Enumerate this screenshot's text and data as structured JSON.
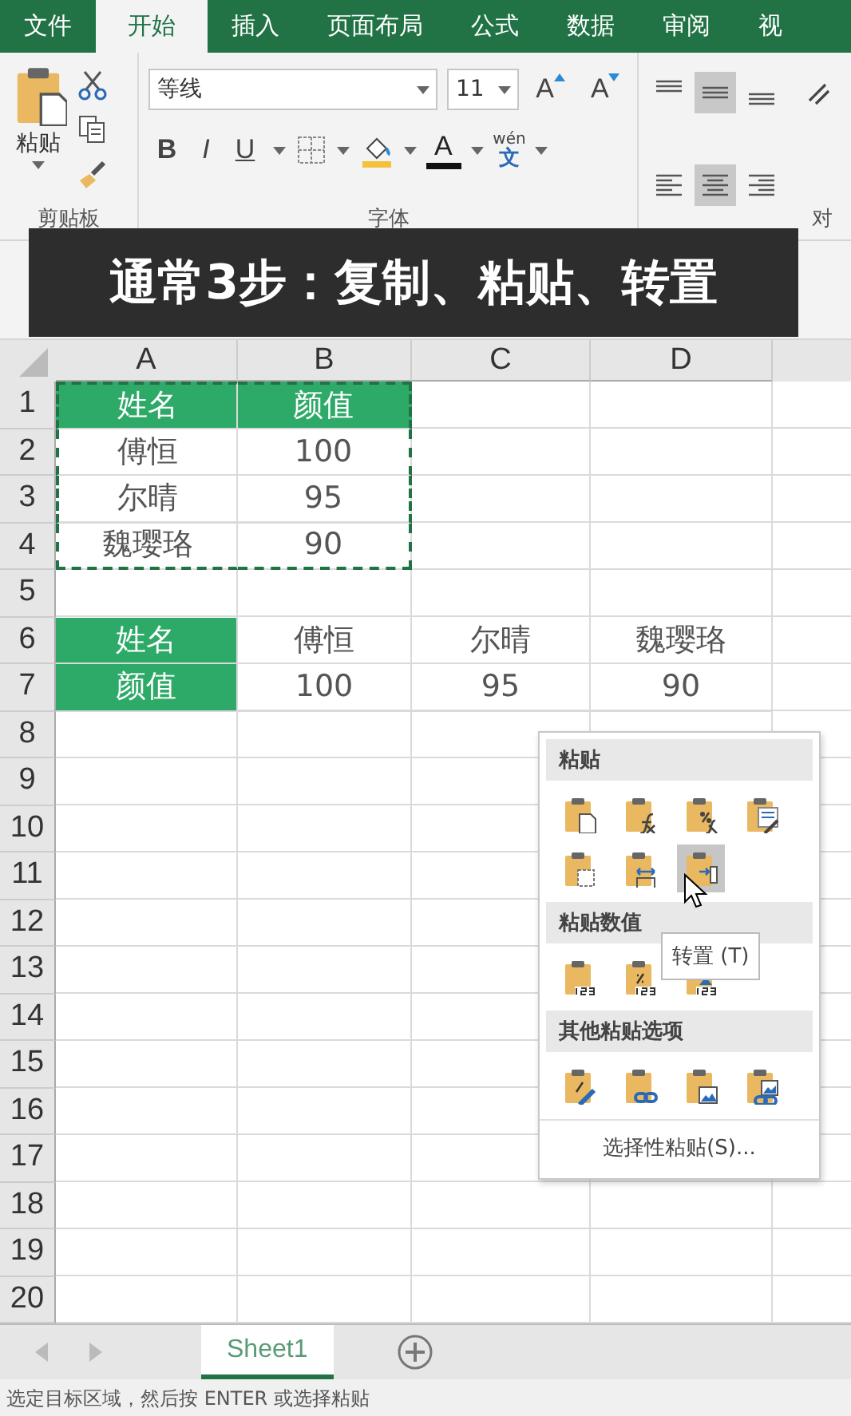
{
  "tabs": [
    {
      "label": "文件",
      "selected": false
    },
    {
      "label": "开始",
      "selected": true
    },
    {
      "label": "插入",
      "selected": false
    },
    {
      "label": "页面布局",
      "selected": false
    },
    {
      "label": "公式",
      "selected": false
    },
    {
      "label": "数据",
      "selected": false
    },
    {
      "label": "审阅",
      "selected": false
    },
    {
      "label": "视",
      "selected": false
    }
  ],
  "ribbon": {
    "paste_label": "粘贴",
    "font_name": "等线",
    "font_size": "11",
    "grow_font": "A",
    "shrink_font": "A",
    "format_buttons": [
      "B",
      "I",
      "U"
    ],
    "font_color": "A",
    "phonetic_top": "wén",
    "phonetic_bottom": "文",
    "align_buttons": [
      {
        "kind": "top",
        "selected": false
      },
      {
        "kind": "middle",
        "selected": true
      },
      {
        "kind": "bottom",
        "selected": false
      },
      {
        "kind": "left",
        "selected": false
      },
      {
        "kind": "center",
        "selected": true
      },
      {
        "kind": "right",
        "selected": false
      }
    ],
    "groups": [
      "剪贴板",
      "字体",
      "对"
    ]
  },
  "caption": "通常3步：复制、粘贴、转置",
  "sheet": {
    "columns": [
      "A",
      "B",
      "C",
      "D"
    ],
    "rows": [
      {
        "number": "1",
        "cells": [
          {
            "text": "姓名",
            "header": true,
            "copied": true
          },
          {
            "text": "颜值",
            "header": true,
            "copied": true
          }
        ]
      },
      {
        "number": "2",
        "cells": [
          {
            "text": "傅恒",
            "header": false,
            "copied": true
          },
          {
            "text": "100",
            "header": false,
            "copied": true
          }
        ]
      },
      {
        "number": "3",
        "cells": [
          {
            "text": "尔晴",
            "header": false,
            "copied": true
          },
          {
            "text": "95",
            "header": false,
            "copied": true
          }
        ]
      },
      {
        "number": "4",
        "cells": [
          {
            "text": "魏璎珞",
            "header": false,
            "copied": true
          },
          {
            "text": "90",
            "header": false,
            "copied": true
          }
        ]
      },
      {
        "number": "5"
      },
      {
        "number": "6",
        "cells": [
          {
            "text": "姓名",
            "header": true,
            "copied": false
          },
          {
            "text": "傅恒",
            "header": false,
            "copied": false
          },
          {
            "text": "尔晴",
            "header": false,
            "copied": false
          },
          {
            "text": "魏璎珞",
            "header": false,
            "copied": false
          }
        ]
      },
      {
        "number": "7",
        "cells": [
          {
            "text": "颜值",
            "header": true,
            "copied": false
          },
          {
            "text": "100",
            "header": false,
            "copied": false
          },
          {
            "text": "95",
            "header": false,
            "copied": false
          },
          {
            "text": "90",
            "header": false,
            "copied": false
          }
        ]
      },
      {
        "number": "8"
      },
      {
        "number": "9"
      },
      {
        "number": "10"
      },
      {
        "number": "11"
      },
      {
        "number": "12"
      },
      {
        "number": "13"
      },
      {
        "number": "14"
      },
      {
        "number": "15"
      },
      {
        "number": "16"
      },
      {
        "number": "17"
      },
      {
        "number": "18"
      },
      {
        "number": "19"
      },
      {
        "number": "20"
      }
    ]
  },
  "context_menu": {
    "sections": [
      {
        "title": "粘贴",
        "items": [
          {
            "kind": "paste",
            "selected": false
          },
          {
            "kind": "formulas",
            "selected": false
          },
          {
            "kind": "formulas-number",
            "selected": false
          },
          {
            "kind": "keep-source",
            "selected": false
          },
          {
            "kind": "no-borders",
            "selected": false
          },
          {
            "kind": "column-widths",
            "selected": false
          },
          {
            "kind": "transpose",
            "selected": true
          }
        ]
      },
      {
        "title": "粘贴数值",
        "items": [
          {
            "kind": "values",
            "selected": false
          },
          {
            "kind": "values-number",
            "selected": false
          },
          {
            "kind": "values-source",
            "selected": false
          }
        ]
      },
      {
        "title": "其他粘贴选项",
        "items": [
          {
            "kind": "formatting",
            "selected": false
          },
          {
            "kind": "link",
            "selected": false
          },
          {
            "kind": "picture",
            "selected": false
          },
          {
            "kind": "linked-picture",
            "selected": false
          }
        ]
      }
    ],
    "footer": "选择性粘贴(S)...",
    "tooltip": "转置 (T)"
  },
  "sheet_tabs": [
    {
      "label": "Sheet1",
      "selected": true
    }
  ],
  "status_bar": "选定目标区域，然后按 ENTER 或选择粘贴"
}
